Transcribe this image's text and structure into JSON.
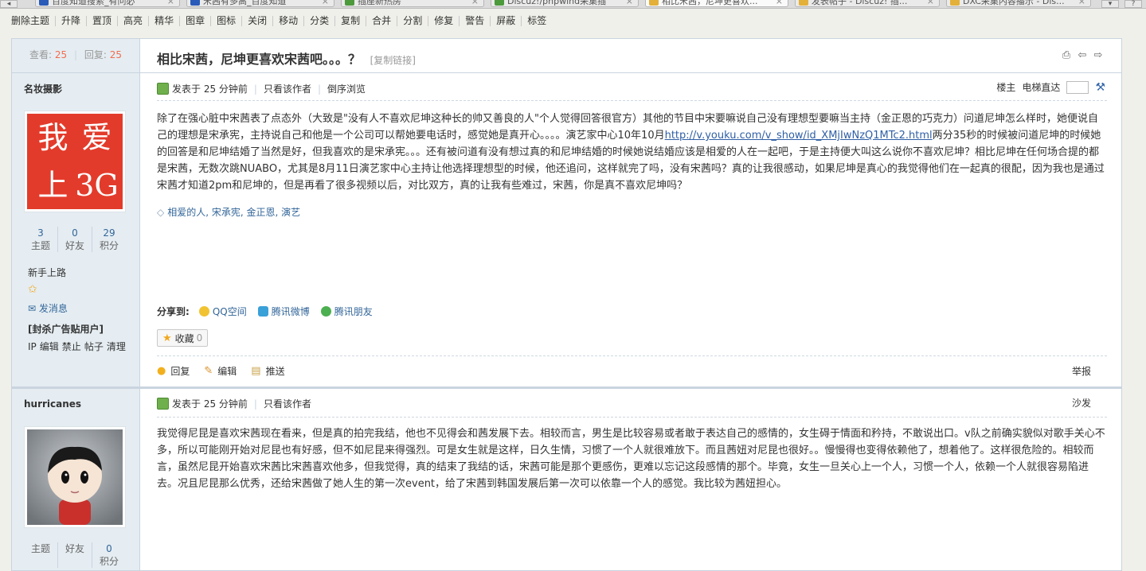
{
  "browser": {
    "tabs": [
      {
        "label": "百度知道搜索_有问必",
        "active": false,
        "icon": "blue"
      },
      {
        "label": "宋茜有多高_百度知道",
        "active": false,
        "icon": "blue"
      },
      {
        "label": "插座新热房",
        "active": false,
        "icon": "green"
      },
      {
        "label": "Discuz!/phpwind采集插",
        "active": false,
        "icon": "green"
      },
      {
        "label": "相比宋茜，尼坤更喜欢...",
        "active": true,
        "icon": "yellow"
      },
      {
        "label": "发表帖子 - Discuz! 插...",
        "active": false,
        "icon": "yellow"
      },
      {
        "label": "DXC采集内容播示 - Dis...",
        "active": false,
        "icon": "yellow"
      }
    ]
  },
  "moderation": {
    "items": [
      "删除主题",
      "升降",
      "置顶",
      "高亮",
      "精华",
      "图章",
      "图标",
      "关闭",
      "移动",
      "分类",
      "复制",
      "合并",
      "分割",
      "修复",
      "警告",
      "屏蔽",
      "标签"
    ]
  },
  "thread": {
    "views_label": "查看:",
    "views": "25",
    "replies_label": "回复:",
    "replies": "25",
    "title": "相比宋茜，尼坤更喜欢宋茜吧。。。？",
    "copy_link": "[复制链接]"
  },
  "posts": [
    {
      "author": "名妆摄影",
      "avatar_type": "seal",
      "avatar_chars": [
        "我",
        "爱",
        "上",
        "3G"
      ],
      "stats": [
        {
          "n": "3",
          "l": "主题"
        },
        {
          "n": "0",
          "l": "好友"
        },
        {
          "n": "29",
          "l": "积分"
        }
      ],
      "rank": "新手上路",
      "send_msg": "发消息",
      "banned_label": "[封杀广告贴用户]",
      "mod_actions": [
        "IP",
        "编辑",
        "禁止",
        "帖子",
        "清理"
      ],
      "posted": "发表于 25 分钟前",
      "author_only": "只看该作者",
      "reverse": "倒序浏览",
      "floor": "楼主",
      "goto_floor": "电梯直达",
      "content_a": "除了在强心脏中宋茜表了点态外（大致是\"没有人不喜欢尼坤这种长的帅又善良的人\"个人觉得回答很官方）其他的节目中宋要嘛说自己没有理想型要嘛当主持（金正恩的巧克力）问道尼坤怎么样时，她便说自己的理想是宋承宪，主持说自己和他是一个公司可以帮她要电话时，感觉她是真开心。。。。演艺家中心10年10月",
      "content_link": "http://v.youku.com/v_show/id_XMjIwNzQ1MTc2.html",
      "content_b": "两分35秒的时候被问道尼坤的时候她的回答是和尼坤结婚了当然是好，但我喜欢的是宋承宪。。。还有被问道有没有想过真的和尼坤结婚的时候她说结婚应该是相爱的人在一起吧，于是主持便大叫这么说你不喜欢尼坤？相比尼坤在任何场合提的都是宋茜，无数次跳NUABO，尤其是8月11日演艺家中心主持让他选择理想型的时候，他还追问，这样就完了吗，没有宋茜吗？真的让我很感动，如果尼坤是真心的我觉得他们在一起真的很配，因为我也是通过宋茜才知道2pm和尼坤的，但是再看了很多视频以后，对比双方，真的让我有些难过，宋茜，你是真不喜欢尼坤吗？",
      "tags": "相爱的人, 宋承宪, 金正恩, 演艺",
      "share_label": "分享到:",
      "share": [
        "QQ空间",
        "腾讯微博",
        "腾讯朋友"
      ],
      "fav_label": "收藏",
      "fav_count": "0",
      "actions": [
        "回复",
        "编辑",
        "推送"
      ],
      "report": "举报"
    },
    {
      "author": "hurricanes",
      "avatar_type": "cartoon",
      "stats": [
        {
          "n": "",
          "l": "主题"
        },
        {
          "n": "",
          "l": "好友"
        },
        {
          "n": "0",
          "l": "积分"
        }
      ],
      "posted": "发表于 25 分钟前",
      "author_only": "只看该作者",
      "floor": "沙发",
      "content": "我觉得尼昆是喜欢宋茜现在看来，但是真的拍完我结，他也不见得会和茜发展下去。相较而言，男生是比较容易或者敢于表达自己的感情的，女生碍于情面和矜持，不敢说出口。v队之前确实貌似对歌手关心不多，所以可能刚开始对尼昆也有好感，但不如尼昆来得强烈。可是女生就是这样，日久生情，习惯了一个人就很难放下。而且茜妞对尼昆也很好。。慢慢得也变得依赖他了，想着他了。这样很危险的。相较而言，虽然尼昆开始喜欢宋茜比宋茜喜欢他多，但我觉得，真的结束了我结的话，宋茜可能是那个更感伤，更难以忘记这段感情的那个。毕竟，女生一旦关心上一个人，习惯一个人，依赖一个人就很容易陷进去。况且尼昆那么优秀，还给宋茜做了她人生的第一次event，给了宋茜到韩国发展后第一次可以依靠一个人的感觉。我比较为茜妞担心。"
    }
  ]
}
